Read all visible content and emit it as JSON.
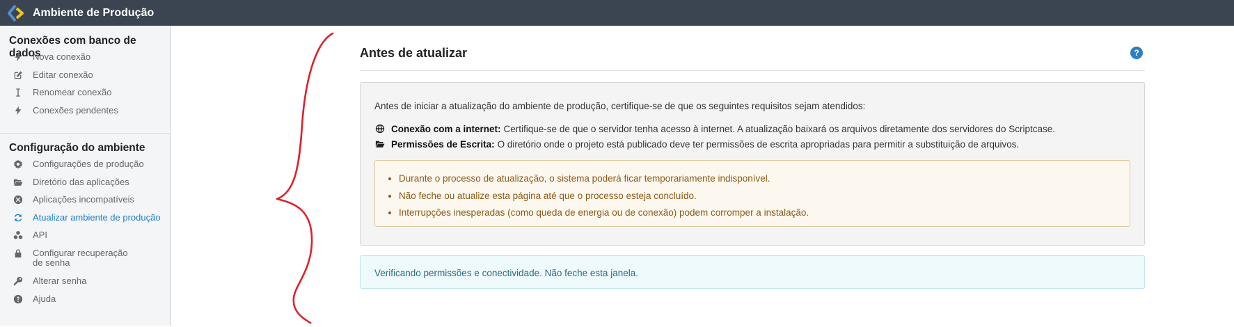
{
  "app": {
    "title": "Ambiente de Produção"
  },
  "sidebar": {
    "section1_title": "Conexões com banco de dados",
    "section1_items": [
      {
        "label": "Nova conexão",
        "icon": "bolt-icon"
      },
      {
        "label": "Editar conexão",
        "icon": "edit-icon"
      },
      {
        "label": "Renomear conexão",
        "icon": "text-cursor-icon"
      },
      {
        "label": "Conexões pendentes",
        "icon": "bolt-icon"
      }
    ],
    "section2_title": "Configuração do ambiente",
    "section2_items": [
      {
        "label": "Configurações de produção",
        "icon": "gear-icon"
      },
      {
        "label": "Diretório das aplicações",
        "icon": "folder-open-icon"
      },
      {
        "label": "Aplicações incompatíveis",
        "icon": "times-circle-icon"
      },
      {
        "label": "Atualizar ambiente de produção",
        "icon": "sync-icon",
        "active": true
      },
      {
        "label": "API",
        "icon": "cubes-icon"
      },
      {
        "label": "Configurar recuperação de senha",
        "icon": "lock-icon"
      },
      {
        "label": "Alterar senha",
        "icon": "key-icon"
      },
      {
        "label": "Ajuda",
        "icon": "question-circle-icon"
      }
    ]
  },
  "main": {
    "title": "Antes de atualizar",
    "help": "?",
    "intro": "Antes de iniciar a atualização do ambiente de produção, certifique-se de que os seguintes requisitos sejam atendidos:",
    "requirements": [
      {
        "label": "Conexão com a internet:",
        "text": "Certifique-se de que o servidor tenha acesso à internet. A atualização baixará os arquivos diretamente dos servidores do Scriptcase.",
        "icon": "globe-icon"
      },
      {
        "label": "Permissões de Escrita:",
        "text": "O diretório onde o projeto está publicado deve ter permissões de escrita apropriadas para permitir a substituição de arquivos.",
        "icon": "folder-open-icon"
      }
    ],
    "warnings": [
      "Durante o processo de atualização, o sistema poderá ficar temporariamente indisponível.",
      "Não feche ou atualize esta página até que o processo esteja concluído.",
      "Interrupções inesperadas (como queda de energia ou de conexão) podem corromper a instalação."
    ],
    "status": "Verificando permissões e conectividade. Não feche esta janela."
  },
  "colors": {
    "topbar": "#3b4552",
    "accent": "#1e7fc6",
    "brace": "#e0202a"
  }
}
